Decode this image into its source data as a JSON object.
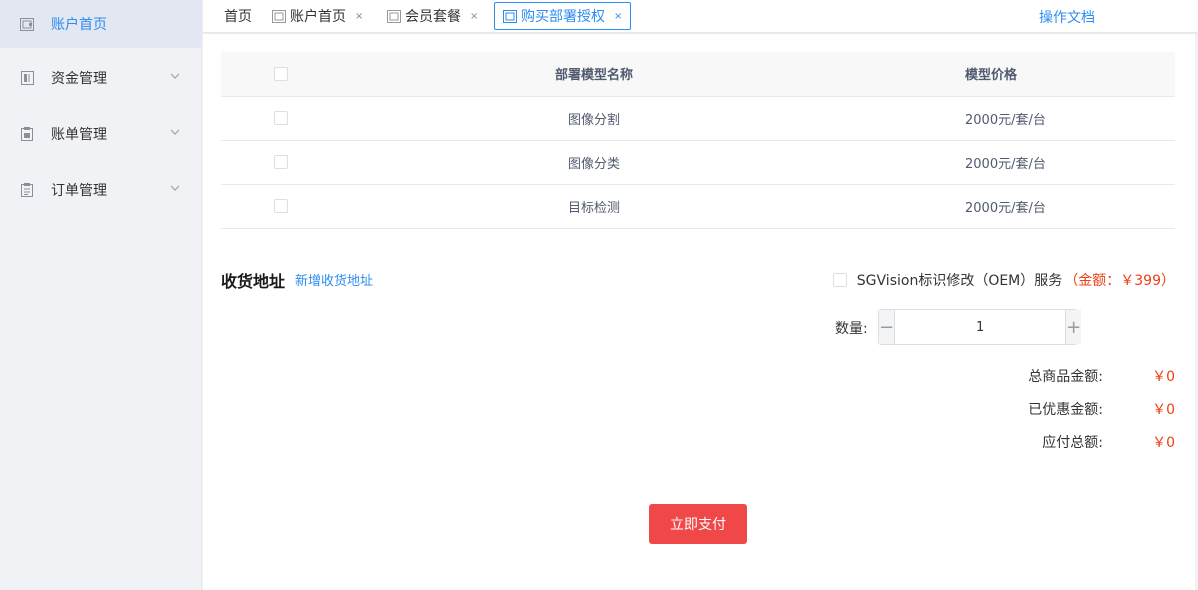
{
  "sidebar": {
    "items": [
      {
        "label": "账户首页",
        "icon": "wallet-icon",
        "active": true
      },
      {
        "label": "资金管理",
        "icon": "ledger-icon",
        "expandable": true
      },
      {
        "label": "账单管理",
        "icon": "clipboard-icon",
        "expandable": true
      },
      {
        "label": "订单管理",
        "icon": "order-icon",
        "expandable": true
      }
    ]
  },
  "tabs": [
    {
      "label": "首页"
    },
    {
      "label": "账户首页",
      "close": "×"
    },
    {
      "label": "会员套餐",
      "close": "×"
    },
    {
      "label": "购买部署授权",
      "close": "×",
      "active": true
    }
  ],
  "header": {
    "doc_link": "操作文档"
  },
  "table": {
    "columns": [
      "部署模型名称",
      "模型价格"
    ],
    "rows": [
      {
        "name": "图像分割",
        "price": "2000元/套/台"
      },
      {
        "name": "图像分类",
        "price": "2000元/套/台"
      },
      {
        "name": "目标检测",
        "price": "2000元/套/台"
      }
    ]
  },
  "address": {
    "title": "收货地址",
    "add_link": "新增收货地址"
  },
  "oem": {
    "label": "SGVision标识修改（OEM）服务",
    "price": "（金额：￥399）"
  },
  "quantity": {
    "label": "数量:",
    "value": "1",
    "minus": "−",
    "plus": "+"
  },
  "summary": {
    "total_label": "总商品金额:",
    "total_value": "￥0",
    "discount_label": "已优惠金额:",
    "discount_value": "￥0",
    "payable_label": "应付总额:",
    "payable_value": "￥0"
  },
  "pay_button": "立即支付",
  "colors": {
    "accent": "#2d8cf0",
    "danger": "#ed4014",
    "pay_button": "#f04848"
  }
}
